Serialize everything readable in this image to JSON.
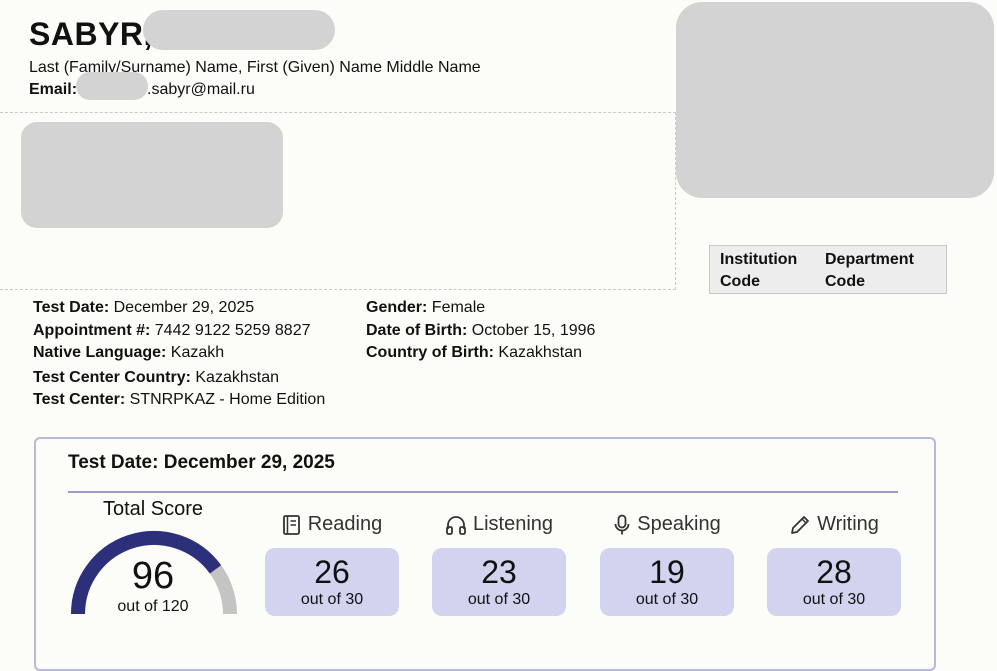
{
  "candidate": {
    "surname": "SABYR,",
    "name_caption": "Last (Family/Surname) Name, First (Given) Name Middle Name",
    "email_label": "Email:",
    "email_visible": ".sabyr@mail.ru"
  },
  "institution_table": {
    "col1": [
      "Institution",
      "Code"
    ],
    "col2": [
      "Department",
      "Code"
    ]
  },
  "info_left": [
    {
      "label": "Test Date:",
      "value": " December 29, 2025"
    },
    {
      "label": "Appointment #:",
      "value": " 7442 9122 5259 8827"
    },
    {
      "label": "Native Language:",
      "value": " Kazakh"
    },
    {
      "label": "Test Center Country:",
      "value": " Kazakhstan"
    },
    {
      "label": "Test Center:",
      "value": " STNRPKAZ - Home Edition"
    }
  ],
  "info_right": [
    {
      "label": "Gender:",
      "value": " Female"
    },
    {
      "label": "Date of Birth:",
      "value": " October 15, 1996"
    },
    {
      "label": "Country of Birth:",
      "value": " Kazakhstan"
    }
  ],
  "score_card": {
    "title": "Test Date: December 29, 2025",
    "total_label": "Total Score",
    "total_score": "96",
    "total_out_of": "out of 120",
    "total_fraction": 0.8,
    "colors": {
      "gauge_fill": "#2c2f7a",
      "gauge_track": "#c4c4c4",
      "box_bg": "#d2d3ee"
    },
    "sections": [
      {
        "label": "Reading",
        "icon": "book-icon",
        "score": "26",
        "out_of": "out of 30"
      },
      {
        "label": "Listening",
        "icon": "headphones-icon",
        "score": "23",
        "out_of": "out of 30"
      },
      {
        "label": "Speaking",
        "icon": "microphone-icon",
        "score": "19",
        "out_of": "out of 30"
      },
      {
        "label": "Writing",
        "icon": "pencil-icon",
        "score": "28",
        "out_of": "out of 30"
      }
    ]
  }
}
